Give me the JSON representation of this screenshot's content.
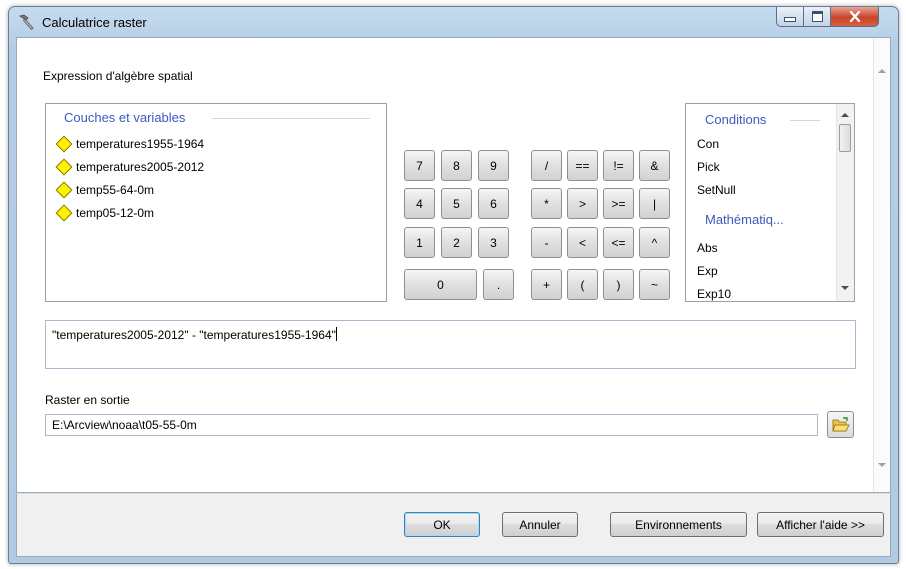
{
  "window": {
    "title": "Calculatrice raster",
    "title_icon": "hammer-icon"
  },
  "expression_section_label": "Expression d'algèbre spatial",
  "layers": {
    "title": "Couches et variables",
    "items": [
      {
        "name": "temperatures1955-1964",
        "icon": "raster-layer-diamond-icon"
      },
      {
        "name": "temperatures2005-2012",
        "icon": "raster-layer-diamond-icon"
      },
      {
        "name": "temp55-64-0m",
        "icon": "raster-layer-diamond-icon"
      },
      {
        "name": "temp05-12-0m",
        "icon": "raster-layer-diamond-icon"
      }
    ]
  },
  "keypad": {
    "digits": [
      "7",
      "8",
      "9",
      "4",
      "5",
      "6",
      "1",
      "2",
      "3",
      "0",
      "."
    ],
    "operators": [
      "/",
      "==",
      "!=",
      "&",
      "*",
      ">",
      ">=",
      "|",
      "-",
      "<",
      "<=",
      "^",
      "+",
      "(",
      ")",
      "~"
    ]
  },
  "functions": {
    "groups": [
      {
        "title": "Conditions",
        "items": [
          "Con",
          "Pick",
          "SetNull"
        ]
      },
      {
        "title": "Mathématiq...",
        "items": [
          "Abs",
          "Exp",
          "Exp10"
        ]
      }
    ]
  },
  "expression_value": "\"temperatures2005-2012\" - \"temperatures1955-1964\"",
  "output": {
    "label": "Raster en sortie",
    "value": "E:\\Arcview\\noaa\\t05-55-0m",
    "browse_icon": "open-folder-icon"
  },
  "buttons": {
    "ok": "OK",
    "cancel": "Annuler",
    "environments": "Environnements",
    "help": "Afficher l'aide >>"
  },
  "colors": {
    "group_title": "#3b5bbf",
    "layer_icon": "#fff200",
    "close_button": "#c8442a"
  }
}
